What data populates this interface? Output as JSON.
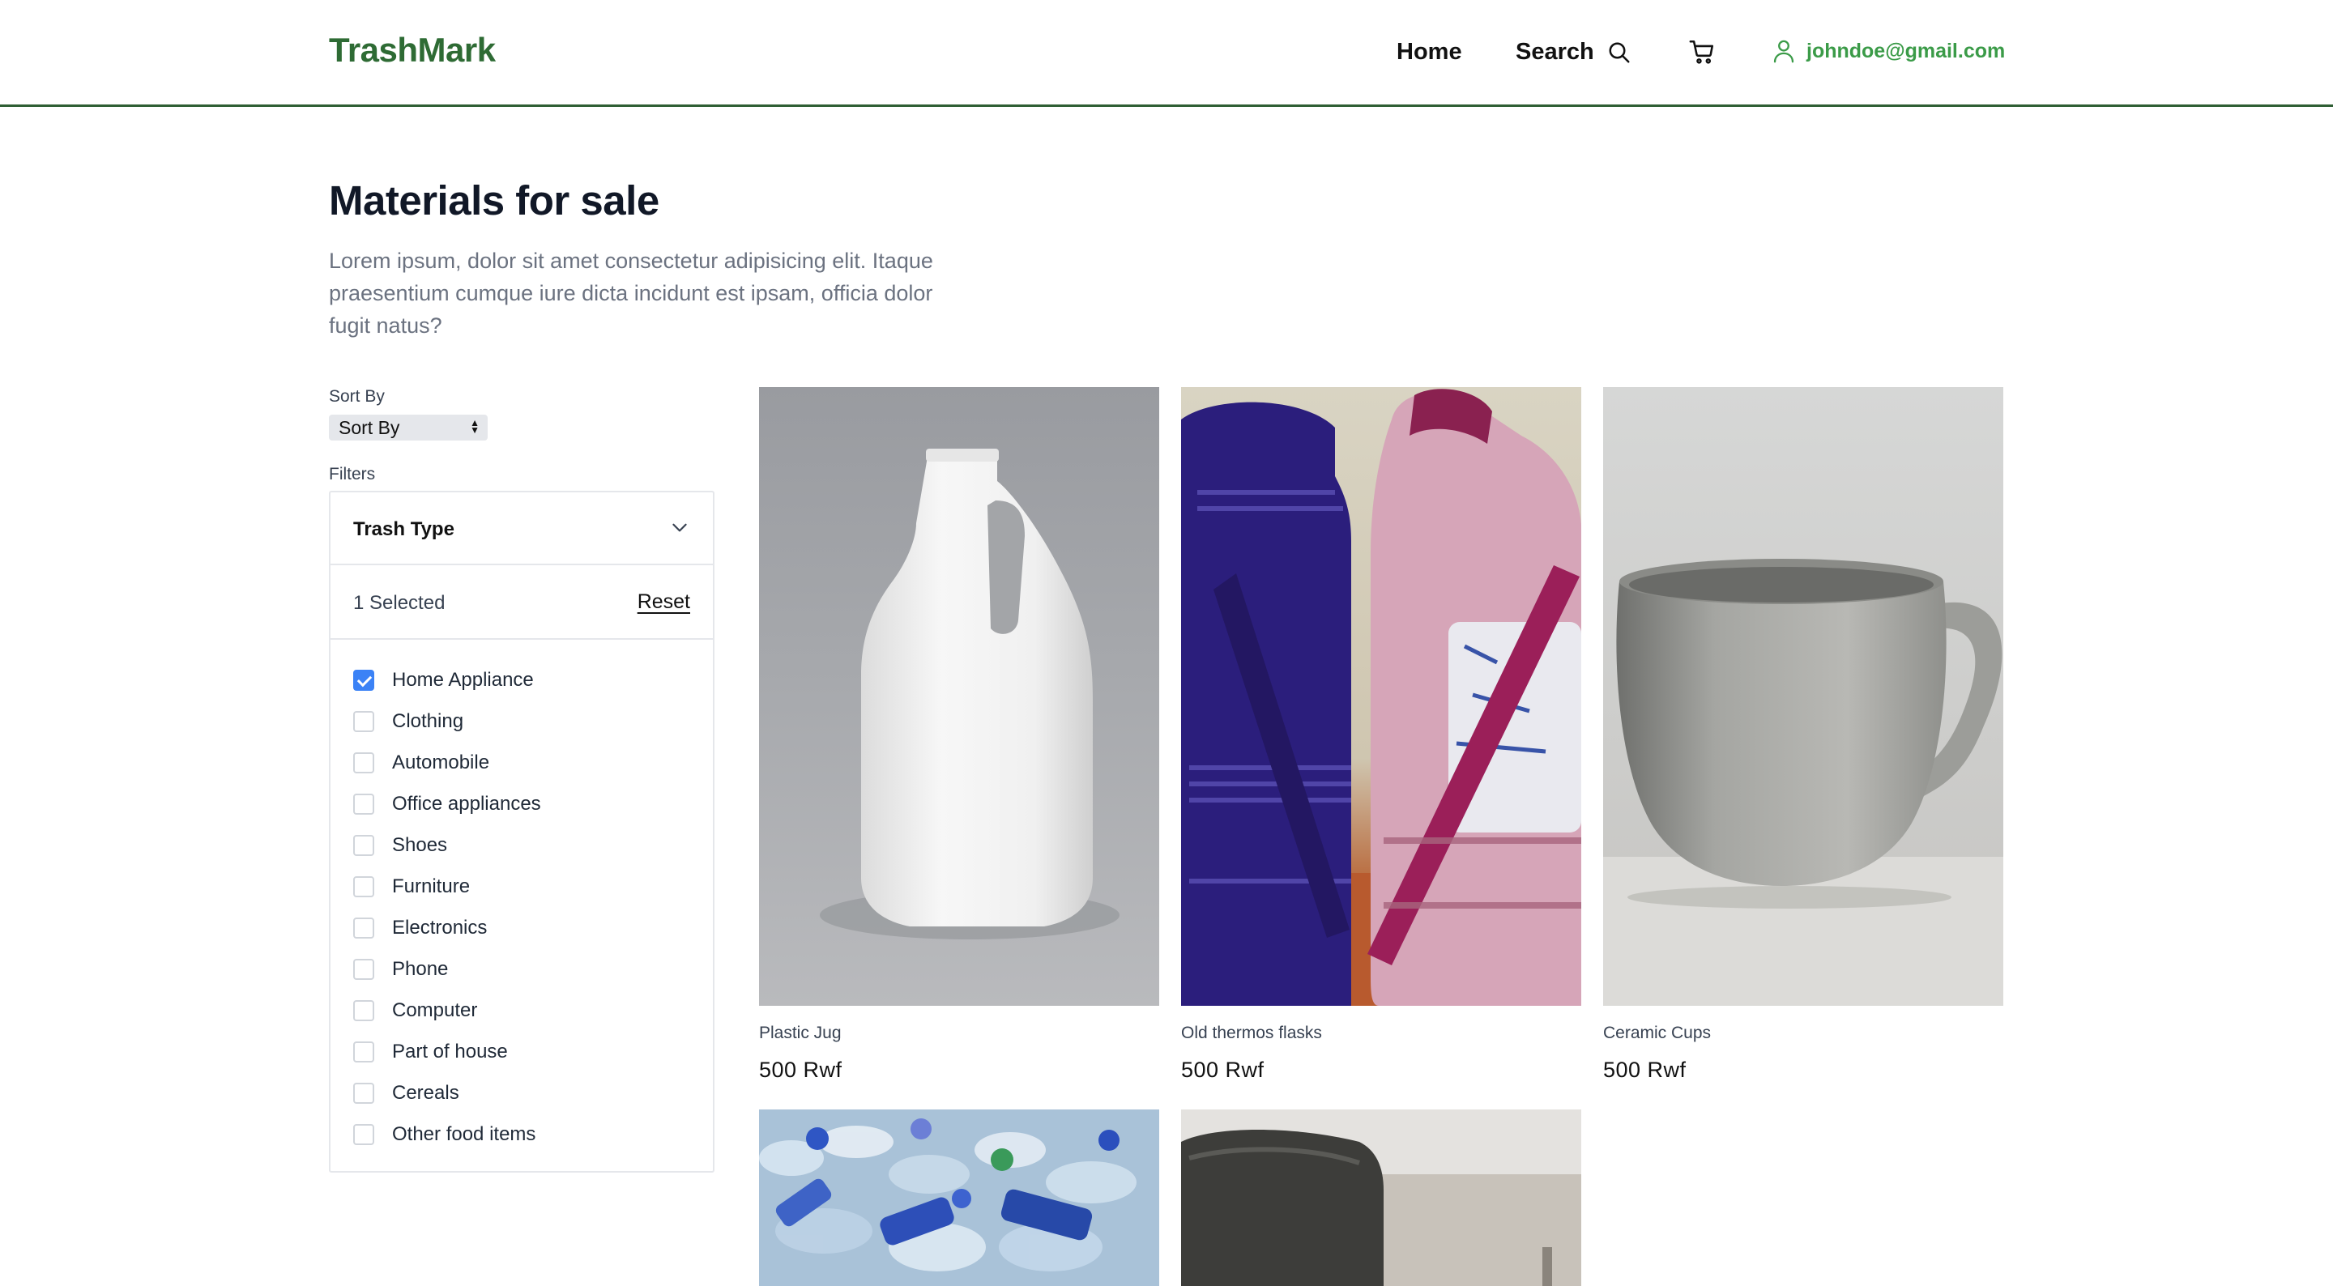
{
  "header": {
    "logo": "TrashMark",
    "nav": {
      "home": "Home",
      "search": "Search"
    },
    "user_email": "johndoe@gmail.com"
  },
  "page": {
    "title": "Materials for sale",
    "description": "Lorem ipsum, dolor sit amet consectetur adipisicing elit. Itaque praesentium cumque iure dicta incidunt est ipsam, officia dolor fugit natus?"
  },
  "sort": {
    "label": "Sort By",
    "selected": "Sort By"
  },
  "filters": {
    "label": "Filters",
    "section_title": "Trash Type",
    "selected_count": "1 Selected",
    "reset_label": "Reset",
    "options": [
      {
        "label": "Home Appliance",
        "checked": true
      },
      {
        "label": "Clothing",
        "checked": false
      },
      {
        "label": "Automobile",
        "checked": false
      },
      {
        "label": "Office appliances",
        "checked": false
      },
      {
        "label": "Shoes",
        "checked": false
      },
      {
        "label": "Furniture",
        "checked": false
      },
      {
        "label": "Electronics",
        "checked": false
      },
      {
        "label": "Phone",
        "checked": false
      },
      {
        "label": "Computer",
        "checked": false
      },
      {
        "label": "Part of house",
        "checked": false
      },
      {
        "label": "Cereals",
        "checked": false
      },
      {
        "label": "Other food items",
        "checked": false
      }
    ]
  },
  "products": [
    {
      "name": "Plastic Jug",
      "price": "500 Rwf"
    },
    {
      "name": "Old thermos flasks",
      "price": "500 Rwf"
    },
    {
      "name": "Ceramic Cups",
      "price": "500 Rwf"
    }
  ],
  "colors": {
    "brand": "#2e6b34",
    "accent": "#3b9b48",
    "checkbox": "#3b82f6"
  },
  "icons": [
    "search-icon",
    "cart-icon",
    "user-icon",
    "chevron-down-icon"
  ]
}
